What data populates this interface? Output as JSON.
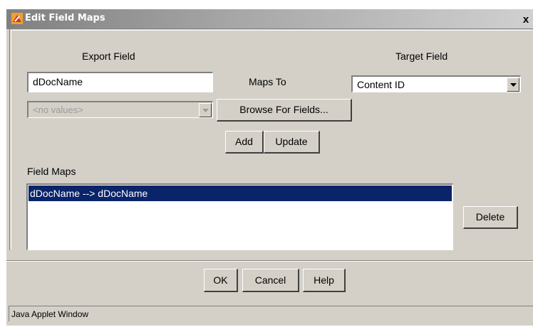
{
  "window": {
    "title": "Edit Field Maps",
    "close_glyph": "x"
  },
  "form": {
    "export_field_label": "Export Field",
    "target_field_label": "Target Field",
    "maps_to_label": "Maps To",
    "export_field_value": "dDocName",
    "values_combo": {
      "value": "<no values>",
      "enabled": false
    },
    "target_combo": {
      "value": "Content ID"
    },
    "browse_button": "Browse For Fields...",
    "add_button": "Add",
    "update_button": "Update"
  },
  "field_maps": {
    "label": "Field Maps",
    "items": [
      "dDocName --> dDocName"
    ],
    "selected_index": 0,
    "delete_button": "Delete"
  },
  "footer": {
    "ok_button": "OK",
    "cancel_button": "Cancel",
    "help_button": "Help"
  },
  "status_bar": {
    "text": "Java Applet Window"
  },
  "colors": {
    "selection": "#0a246a",
    "dialog_bg": "#d4d0c8"
  }
}
